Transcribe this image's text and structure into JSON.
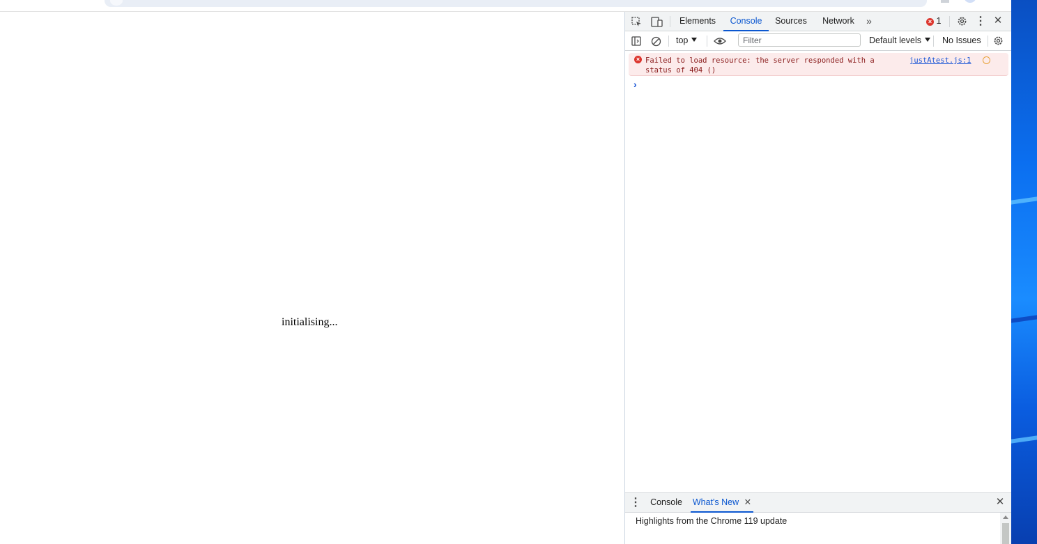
{
  "page": {
    "status_text": "initialising..."
  },
  "devtools": {
    "tabs": [
      "Elements",
      "Console",
      "Sources",
      "Network"
    ],
    "active_tab": "Console",
    "error_count": "1",
    "toolbar": {
      "context": "top",
      "filter_placeholder": "Filter",
      "levels": "Default levels",
      "issues": "No Issues"
    },
    "messages": [
      {
        "level": "error",
        "text": "Failed to load resource: the server responded with a status of 404 ()",
        "source": "justAtest.js:1"
      }
    ],
    "drawer": {
      "tabs": [
        "Console",
        "What's New"
      ],
      "active_tab": "What's New",
      "content": "Highlights from the Chrome 119 update"
    }
  },
  "colors": {
    "accent": "#0b57d0",
    "error": "#dc362e",
    "error_bg": "#fcebeb"
  }
}
